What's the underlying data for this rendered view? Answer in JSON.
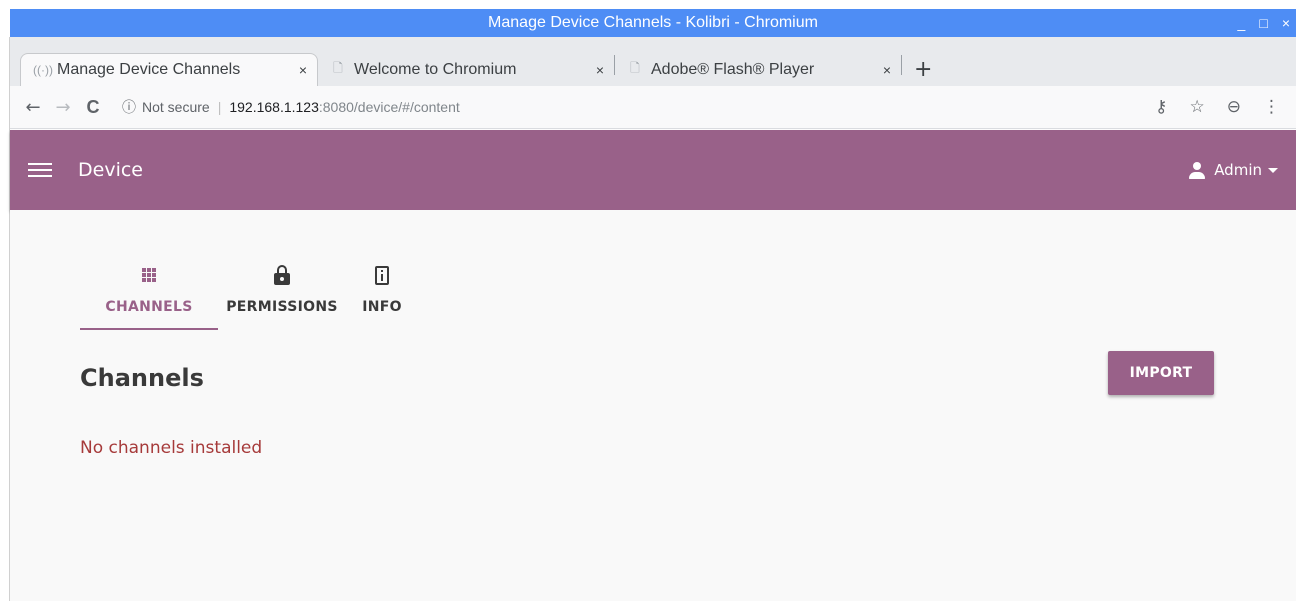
{
  "window": {
    "title": "Manage Device Channels - Kolibri - Chromium",
    "controls": {
      "minimize": "_",
      "maximize": "□",
      "close": "×"
    }
  },
  "browser_tabs": [
    {
      "title": "Manage Device Channels",
      "close": "×",
      "active": true
    },
    {
      "title": "Welcome to Chromium",
      "close": "×",
      "active": false
    },
    {
      "title": "Adobe® Flash® Player",
      "close": "×",
      "active": false
    }
  ],
  "new_tab": "+",
  "toolbar": {
    "back": "←",
    "forward": "→",
    "reload": "C",
    "security_label": "Not secure",
    "url_host": "192.168.1.123",
    "url_path": ":8080/device/#/content",
    "key_icon": "⚷",
    "star_icon": "☆",
    "account_icon": "⊖",
    "menu_icon": "⋮"
  },
  "appbar": {
    "title": "Device",
    "user_label": "Admin"
  },
  "content_tabs": [
    {
      "label": "CHANNELS",
      "icon": "grid-icon",
      "active": true
    },
    {
      "label": "PERMISSIONS",
      "icon": "lock-icon",
      "active": false
    },
    {
      "label": "INFO",
      "icon": "device-info-icon",
      "active": false
    }
  ],
  "main": {
    "heading": "Channels",
    "import_label": "IMPORT",
    "empty_message": "No channels installed"
  },
  "colors": {
    "brand": "#996189",
    "titlebar": "#4e8df5",
    "error_text": "#a63a3a"
  }
}
